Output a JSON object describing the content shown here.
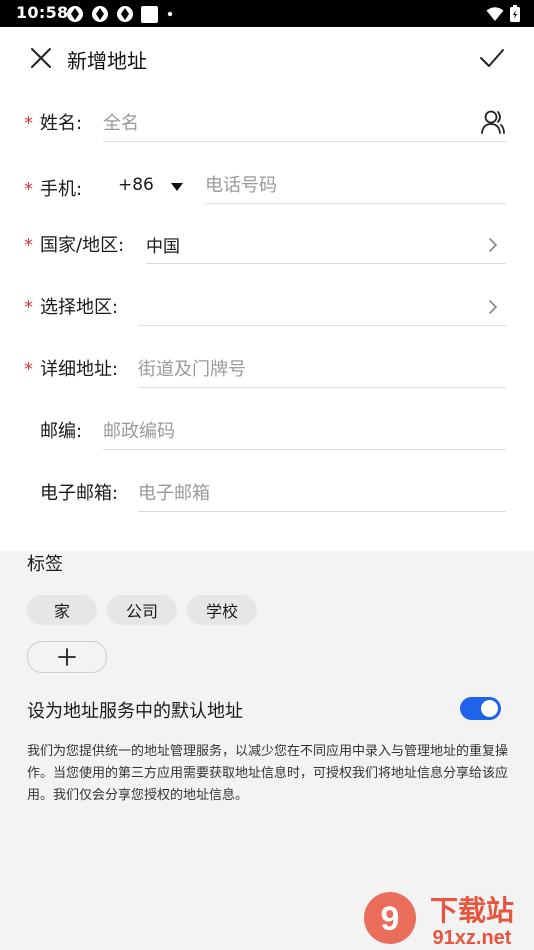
{
  "status_bar": {
    "time": "10:58"
  },
  "app_bar": {
    "title": "新增地址",
    "close_icon": "close-icon",
    "confirm_icon": "check-icon"
  },
  "form": {
    "name": {
      "label": "姓名:",
      "placeholder": "全名",
      "required": true
    },
    "phone": {
      "label": "手机:",
      "country_code": "+86",
      "placeholder": "电话号码",
      "required": true
    },
    "country": {
      "label": "国家/地区:",
      "value": "中国",
      "required": true
    },
    "region": {
      "label": "选择地区:",
      "value": "",
      "required": true
    },
    "detail": {
      "label": "详细地址:",
      "placeholder": "街道及门牌号",
      "required": true
    },
    "postcode": {
      "label": "邮编:",
      "placeholder": "邮政编码",
      "required": false
    },
    "email": {
      "label": "电子邮箱:",
      "placeholder": "电子邮箱",
      "required": false
    },
    "required_mark": "*"
  },
  "tags": {
    "title": "标签",
    "items": [
      "家",
      "公司",
      "学校"
    ]
  },
  "default_setting": {
    "label": "设为地址服务中的默认地址",
    "enabled": true
  },
  "note": "我们为您提供统一的地址管理服务，以减少您在不同应用中录入与管理地址的重复操作。当您使用的第三方应用需要获取地址信息时，可授权我们将地址信息分享给该应用。我们仅会分享您授权的地址信息。",
  "watermark": {
    "brand": "下载站",
    "domain": "91xz.net"
  },
  "colors": {
    "accent": "#1e63e9",
    "required": "#e53935",
    "background": "#f3f3f3"
  }
}
